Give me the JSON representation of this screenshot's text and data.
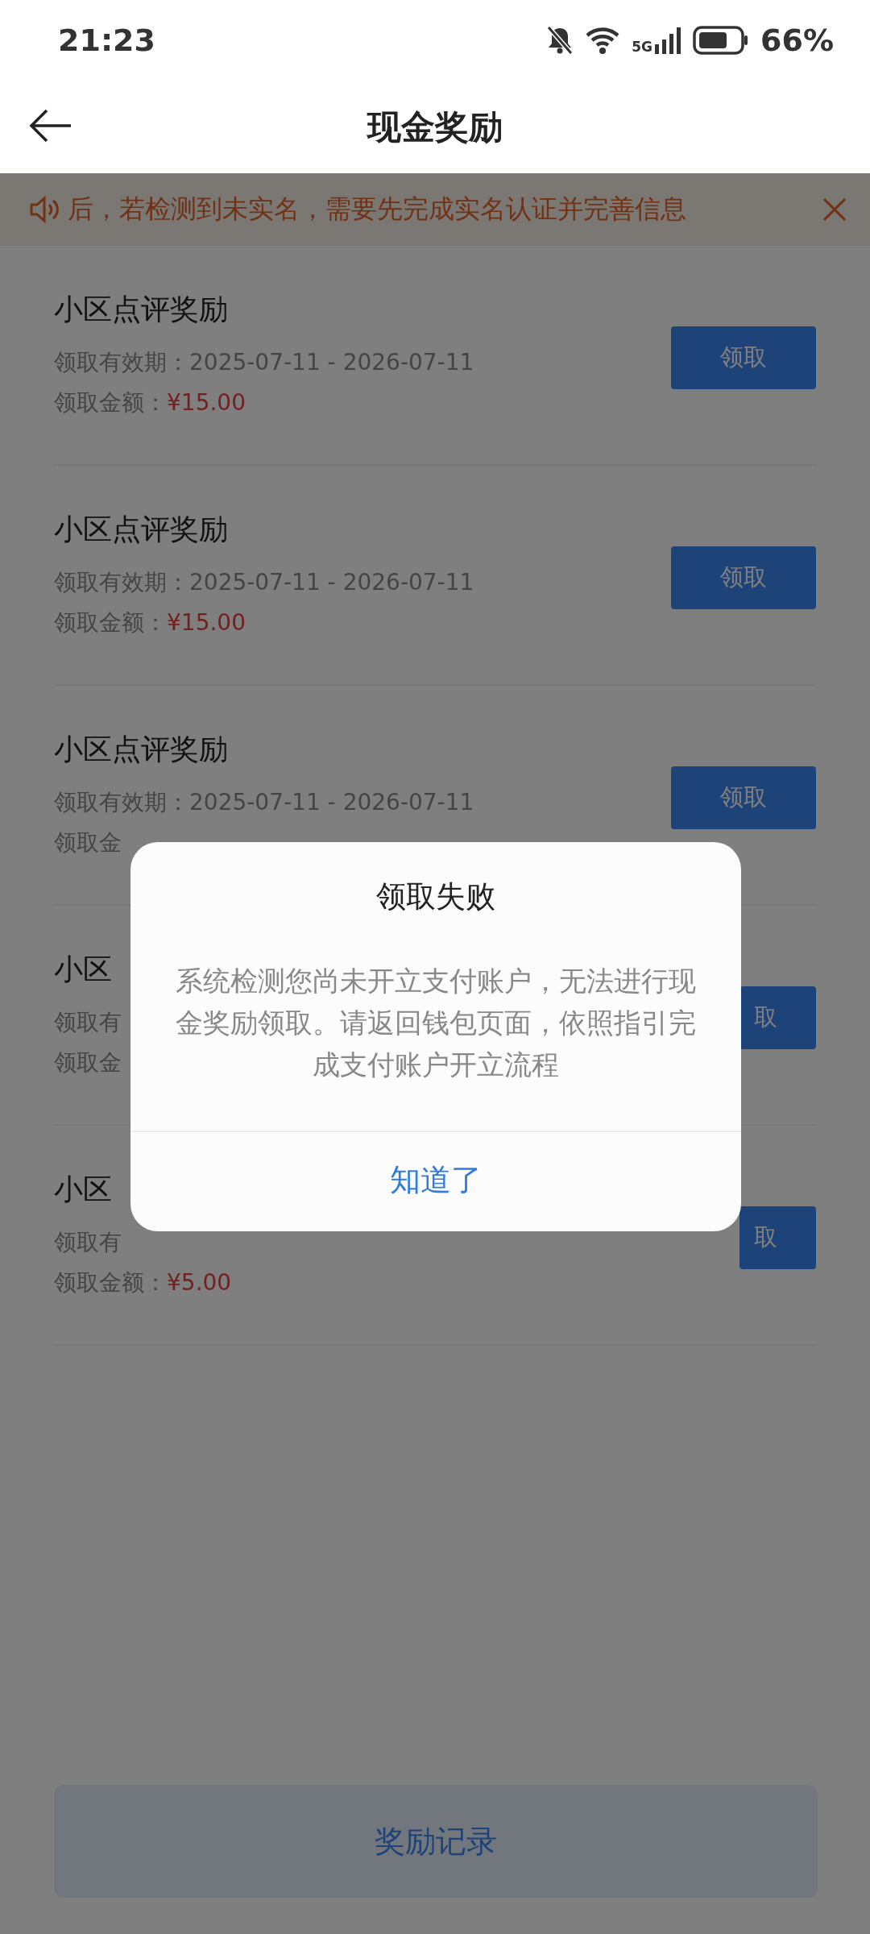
{
  "status_bar": {
    "time": "21:23",
    "network": "5G",
    "battery": "66%"
  },
  "header": {
    "title": "现金奖励"
  },
  "notice": {
    "text": "后，若检测到未实名，需要先完成实名认证并完善信息"
  },
  "rewards": [
    {
      "title": "小区点评奖励",
      "validity_label": "领取有效期：",
      "validity": "2025-07-11 - 2026-07-11",
      "amount_label": "领取金额：",
      "amount": "¥15.00",
      "button": "领取"
    },
    {
      "title": "小区点评奖励",
      "validity_label": "领取有效期：",
      "validity": "2025-07-11 - 2026-07-11",
      "amount_label": "领取金额：",
      "amount": "¥15.00",
      "button": "领取"
    },
    {
      "title": "小区点评奖励",
      "validity_label": "领取有效期：",
      "validity": "2025-07-11 - 2026-07-11",
      "amount_label": "领取金",
      "button": "领取"
    },
    {
      "title": "小区",
      "validity_label": "领取有",
      "amount_label": "领取金",
      "button": "取"
    },
    {
      "title": "小区",
      "validity_label": "领取有",
      "amount_label": "领取金额：",
      "amount": "¥5.00",
      "button": "取"
    }
  ],
  "bottom_button": "奖励记录",
  "dialog": {
    "title": "领取失败",
    "message": "系统检测您尚未开立支付账户，无法进行现金奖励领取。请返回钱包页面，依照指引完成支付账户开立流程",
    "button": "知道了"
  }
}
